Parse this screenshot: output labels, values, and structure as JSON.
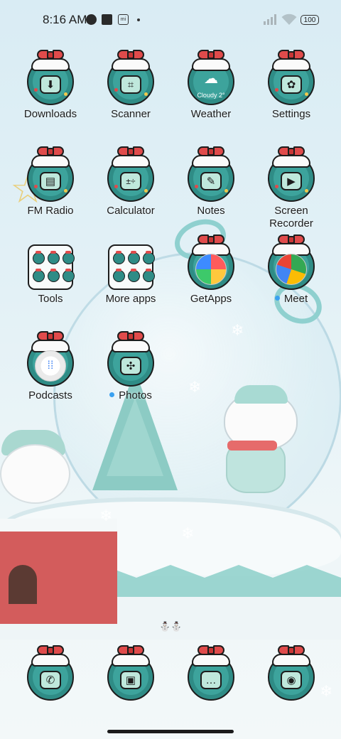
{
  "status_bar": {
    "time": "8:16 AM",
    "mi_label": "mi",
    "battery": "100"
  },
  "apps": [
    {
      "label": "Downloads",
      "icon": "download-icon"
    },
    {
      "label": "Scanner",
      "icon": "scan-icon"
    },
    {
      "label": "Weather",
      "icon": "cloud-icon",
      "overlay": "Cloudy  2°"
    },
    {
      "label": "Settings",
      "icon": "settings-icon"
    },
    {
      "label": "FM Radio",
      "icon": "radio-icon"
    },
    {
      "label": "Calculator",
      "icon": "calculator-icon"
    },
    {
      "label": "Notes",
      "icon": "notes-icon"
    },
    {
      "label": "Screen\nRecorder",
      "icon": "video-icon"
    },
    {
      "label": "Tools",
      "icon": "folder-icon"
    },
    {
      "label": "More apps",
      "icon": "folder-icon"
    },
    {
      "label": "GetApps",
      "icon": "getapps-icon"
    },
    {
      "label": "Meet",
      "icon": "meet-icon",
      "badge": true
    },
    {
      "label": "Podcasts",
      "icon": "podcasts-icon"
    },
    {
      "label": "Photos",
      "icon": "photos-icon",
      "badge": true
    }
  ],
  "dock": [
    {
      "icon": "phone-icon"
    },
    {
      "icon": "gallery-icon"
    },
    {
      "icon": "messages-icon"
    },
    {
      "icon": "camera-icon"
    }
  ],
  "page_indicator": "⛄⛄",
  "colors": {
    "wreath": "#2f8c86",
    "bow": "#e04b4b",
    "badge": "#3aa1f0"
  }
}
